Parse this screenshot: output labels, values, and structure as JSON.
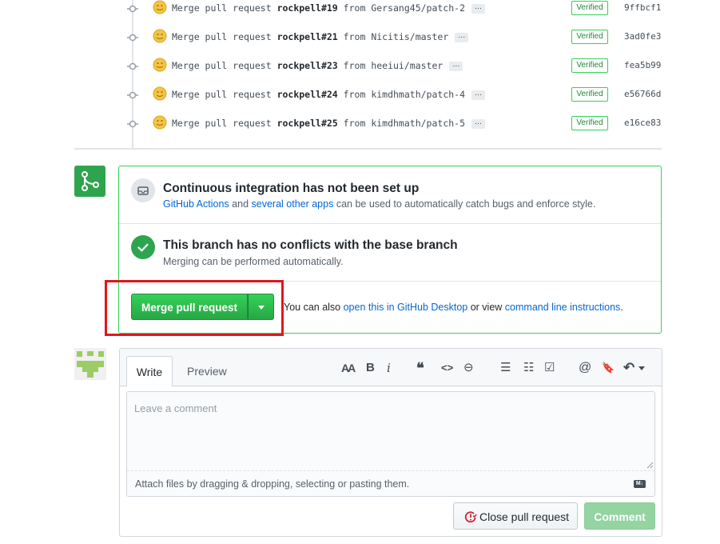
{
  "commits": [
    {
      "prefix": "Merge pull request ",
      "ref": "rockpell#19",
      "from_word": "from",
      "branch": "Gersang45/patch-2",
      "ellipsis": "…",
      "verified": "Verified",
      "sha": "9ffbcf1"
    },
    {
      "prefix": "Merge pull request ",
      "ref": "rockpell#21",
      "from_word": "from",
      "branch": "Nicitis/master",
      "ellipsis": "…",
      "verified": "Verified",
      "sha": "3ad0fe3"
    },
    {
      "prefix": "Merge pull request ",
      "ref": "rockpell#23",
      "from_word": "from",
      "branch": "heeiui/master",
      "ellipsis": "…",
      "verified": "Verified",
      "sha": "fea5b99"
    },
    {
      "prefix": "Merge pull request ",
      "ref": "rockpell#24",
      "from_word": "from",
      "branch": "kimdhmath/patch-4",
      "ellipsis": "…",
      "verified": "Verified",
      "sha": "e56766d"
    },
    {
      "prefix": "Merge pull request ",
      "ref": "rockpell#25",
      "from_word": "from",
      "branch": "kimdhmath/patch-5",
      "ellipsis": "…",
      "verified": "Verified",
      "sha": "e16ce83"
    }
  ],
  "ci": {
    "title": "Continuous integration has not been set up",
    "link1": "GitHub Actions",
    "mid": " and ",
    "link2": "several other apps",
    "rest": " can be used to automatically catch bugs and enforce style."
  },
  "conflicts": {
    "title": "This branch has no conflicts with the base branch",
    "subtitle": "Merging can be performed automatically."
  },
  "merge": {
    "button": "Merge pull request",
    "alt_prefix": "You can also ",
    "alt_link1": "open this in GitHub Desktop",
    "alt_mid": " or view ",
    "alt_link2": "command line instructions",
    "alt_suffix": "."
  },
  "comment": {
    "tab_write": "Write",
    "tab_preview": "Preview",
    "toolbar": {
      "heading": "AA",
      "bold": "B",
      "italic": "i",
      "quote": "❝",
      "code": "<>",
      "link": "⊖",
      "ul": "☰",
      "ol": "☷",
      "tasks": "☑",
      "mention": "@",
      "ref": "🔖",
      "reply": "↶"
    },
    "placeholder": "Leave a comment",
    "attach": "Attach files by dragging & dropping, selecting or pasting them.",
    "md_badge": "M↓",
    "close_button": "Close pull request",
    "comment_button": "Comment"
  },
  "colors": {
    "green": "#2ea44f",
    "link": "#0366d6",
    "highlight": "#e3151a",
    "verified": "#22863a"
  }
}
